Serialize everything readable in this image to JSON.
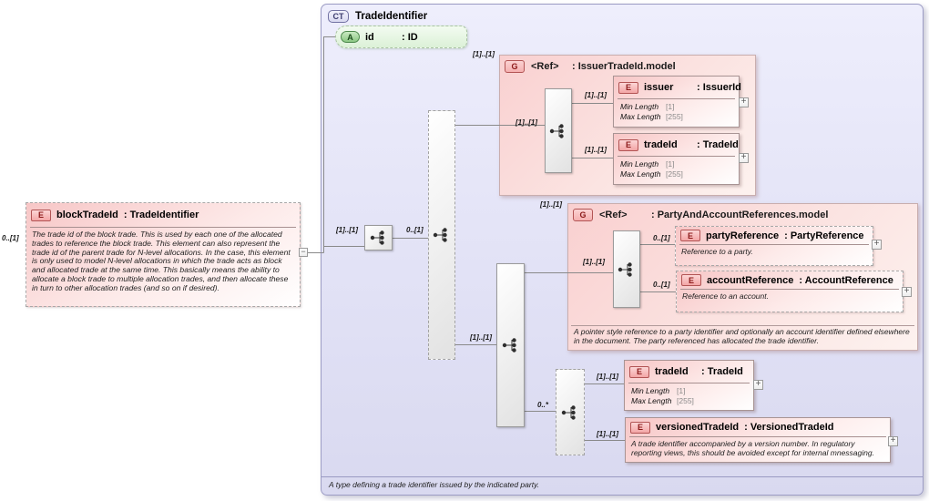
{
  "colors": {
    "container_fill": "#e4e4f7",
    "group_fill": "#f9d0d0",
    "element_fill": "#f7c6c6",
    "attribute_fill": "#dcf1d7",
    "connector": "#8a8a8a"
  },
  "toggle": {
    "expand": "+",
    "collapse": "−"
  },
  "ct": {
    "badge": "CT",
    "title": "TradeIdentifier",
    "doc": "A type defining a trade identifier issued by the indicated party."
  },
  "block": {
    "badge": "E",
    "name": "blockTradeId",
    "type": ": TradeIdentifier",
    "doc": "The trade id of the block trade. This is used by each one of the allocated trades to reference the block trade. This element can also represent the trade id of the parent trade for N-level allocations. In the case, this element is only used to model N-level allocations in which the trade acts as block and allocated trade at the same time. This basically means the ability to allocate a block trade to multiple allocation trades, and then allocate these in turn to other allocation trades (and so on if desired)."
  },
  "attr": {
    "badge": "A",
    "name": "id",
    "type": ": ID"
  },
  "group1": {
    "badge": "G",
    "name": "<Ref>",
    "type": ": IssuerTradeId.model"
  },
  "group2": {
    "badge": "G",
    "name": "<Ref>",
    "type": ": PartyAndAccountReferences.model",
    "doc": "A pointer style reference to a party identifier and optionally an account identifier defined elsewhere in the document. The party referenced has allocated the trade identifier."
  },
  "issuer": {
    "badge": "E",
    "name": "issuer",
    "type": ": IssuerId",
    "facets": [
      {
        "k": "Min Length",
        "v": "[1]"
      },
      {
        "k": "Max Length",
        "v": "[255]"
      }
    ]
  },
  "tradeid1": {
    "badge": "E",
    "name": "tradeId",
    "type": ": TradeId",
    "facets": [
      {
        "k": "Min Length",
        "v": "[1]"
      },
      {
        "k": "Max Length",
        "v": "[255]"
      }
    ]
  },
  "party": {
    "badge": "E",
    "name": "partyReference",
    "type": ": PartyReference",
    "doc": "Reference to a party."
  },
  "account": {
    "badge": "E",
    "name": "accountReference",
    "type": ": AccountReference",
    "doc": "Reference to an account."
  },
  "tradeid2": {
    "badge": "E",
    "name": "tradeId",
    "type": ": TradeId",
    "facets": [
      {
        "k": "Min Length",
        "v": "[1]"
      },
      {
        "k": "Max Length",
        "v": "[255]"
      }
    ]
  },
  "versioned": {
    "badge": "E",
    "name": "versionedTradeId",
    "type": ": VersionedTradeId",
    "doc": "A trade identifier accompanied by a version number. In regulatory reporting views, this should be avoided except for internal mnessaging."
  },
  "cards": {
    "block": "0..[1]",
    "main_in": "[1]..[1]",
    "main_out": "0..[1]",
    "group1": "[1]..[1]",
    "group1_inner": "[1]..[1]",
    "issuer": "[1]..[1]",
    "tradeid1": "[1]..[1]",
    "solid_in": "[1]..[1]",
    "group2": "[1]..[1]",
    "group2_inner": "[1]..[1]",
    "party": "0..[1]",
    "account": "0..[1]",
    "repeat": "0..*",
    "tradeid2": "[1]..[1]",
    "versioned": "[1]..[1]"
  }
}
